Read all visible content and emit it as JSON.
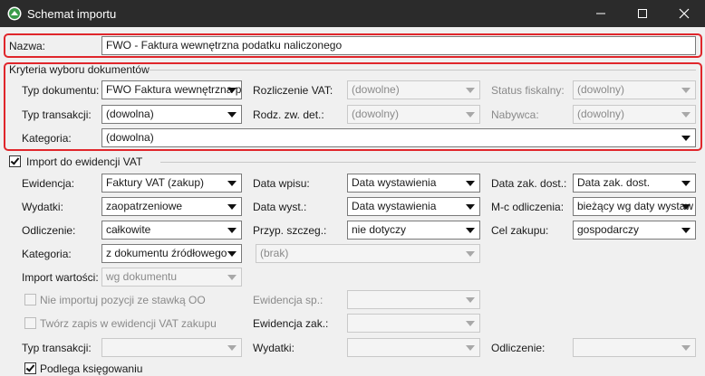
{
  "window": {
    "title": "Schemat importu",
    "minimize_icon": "minimize-icon",
    "maximize_icon": "maximize-icon",
    "close_icon": "close-icon"
  },
  "nazwa": {
    "label": "Nazwa:",
    "value": "FWO - Faktura wewnętrzna podatku naliczonego"
  },
  "kryteria": {
    "title": "Kryteria wyboru dokumentów",
    "typ_dokumentu": {
      "label": "Typ dokumentu:",
      "value": "FWO Faktura wewnętrzna p"
    },
    "rozliczenie_vat": {
      "label": "Rozliczenie VAT:",
      "value": "(dowolne)"
    },
    "status_fiskalny": {
      "label": "Status fiskalny:",
      "value": "(dowolny)"
    },
    "typ_transakcji": {
      "label": "Typ transakcji:",
      "value": "(dowolna)"
    },
    "rodz_zw_det": {
      "label": "Rodz. zw. det.:",
      "value": "(dowolny)"
    },
    "nabywca": {
      "label": "Nabywca:",
      "value": "(dowolny)"
    },
    "kategoria": {
      "label": "Kategoria:",
      "value": "(dowolna)"
    }
  },
  "import_vat": {
    "checkbox_label": "Import do ewidencji VAT",
    "checked": true,
    "ewidencja": {
      "label": "Ewidencja:",
      "value": "Faktury VAT (zakup)"
    },
    "data_wpisu": {
      "label": "Data wpisu:",
      "value": "Data wystawienia"
    },
    "data_zak_dost": {
      "label": "Data zak. dost.:",
      "value": "Data zak. dost."
    },
    "wydatki": {
      "label": "Wydatki:",
      "value": "zaopatrzeniowe"
    },
    "data_wyst": {
      "label": "Data wyst.:",
      "value": "Data wystawienia"
    },
    "mc_odliczenia": {
      "label": "M-c odliczenia:",
      "value": "bieżący wg daty wystaw"
    },
    "odliczenie": {
      "label": "Odliczenie:",
      "value": "całkowite"
    },
    "przyp_szczeg": {
      "label": "Przyp. szczeg.:",
      "value": "nie dotyczy"
    },
    "cel_zakupu": {
      "label": "Cel zakupu:",
      "value": "gospodarczy"
    },
    "kategoria": {
      "label": "Kategoria:",
      "value": "z dokumentu źródłowego",
      "extra_value": "(brak)"
    },
    "import_wartosci": {
      "label": "Import wartości:",
      "value": "wg dokumentu"
    },
    "nie_importuj_label": "Nie importuj pozycji ze stawką OO",
    "ewidencja_sp": {
      "label": "Ewidencja sp.:",
      "value": ""
    },
    "tworz_zapis_label": "Twórz zapis w ewidencji VAT zakupu",
    "ewidencja_zak": {
      "label": "Ewidencja zak.:",
      "value": ""
    },
    "typ_transakcji": {
      "label": "Typ transakcji:",
      "value": ""
    },
    "wydatki2": {
      "label": "Wydatki:",
      "value": ""
    },
    "odliczenie2": {
      "label": "Odliczenie:",
      "value": ""
    }
  },
  "podlega": {
    "label": "Podlega księgowaniu",
    "checked": true
  },
  "colors": {
    "titlebar": "#2b2b2b",
    "highlight": "#e0262b",
    "background": "#f0f0f0"
  }
}
